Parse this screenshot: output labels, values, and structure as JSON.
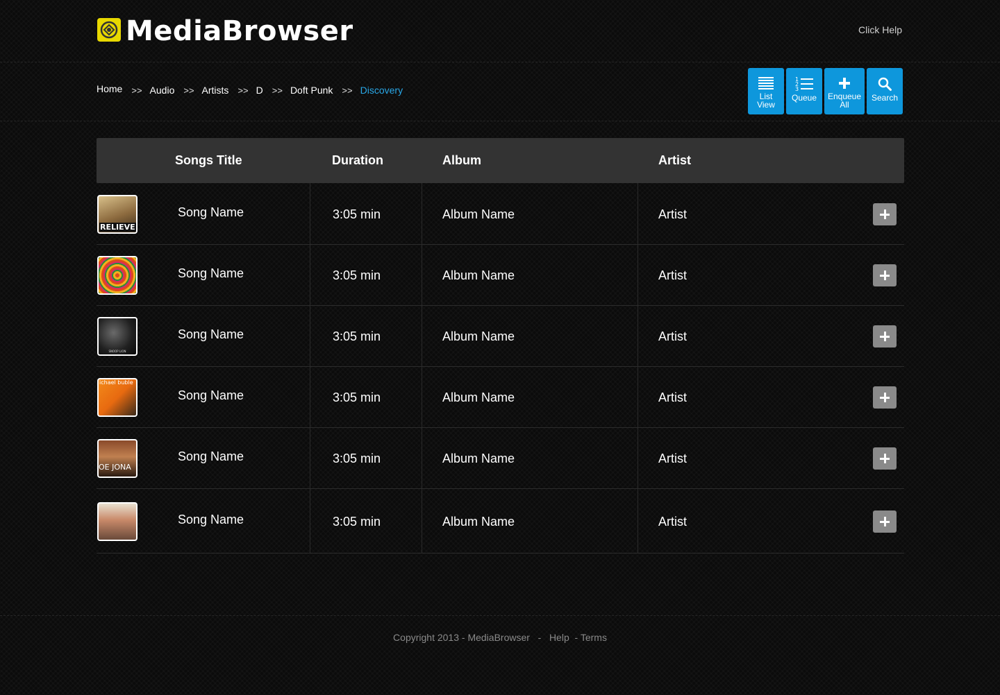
{
  "header": {
    "brand": "MediaBrowser",
    "help_link": "Click Help"
  },
  "breadcrumb": {
    "separator": ">>",
    "items": [
      "Home",
      "Audio",
      "Artists",
      "D",
      "Doft Punk"
    ],
    "current": "Discovery"
  },
  "toolbar": {
    "list_view_line1": "List",
    "list_view_line2": "View",
    "queue": "Queue",
    "enqueue_line1": "Enqueue",
    "enqueue_line2": "All",
    "search": "Search",
    "color": "#0e97dc"
  },
  "table": {
    "columns": [
      "Songs Title",
      "Duration",
      "Album",
      "Artist"
    ],
    "rows": [
      {
        "title": "Song Name",
        "duration": "3:05 min",
        "album": "Album Name",
        "artist": "Artist",
        "cover_text": "RELIEVE"
      },
      {
        "title": "Song Name",
        "duration": "3:05 min",
        "album": "Album Name",
        "artist": "Artist",
        "cover_text": ""
      },
      {
        "title": "Song Name",
        "duration": "3:05 min",
        "album": "Album Name",
        "artist": "Artist",
        "cover_text": "SNOOP LION"
      },
      {
        "title": "Song Name",
        "duration": "3:05 min",
        "album": "Album Name",
        "artist": "Artist",
        "cover_text": "ichael buble"
      },
      {
        "title": "Song Name",
        "duration": "3:05 min",
        "album": "Album Name",
        "artist": "Artist",
        "cover_text": "OE JONA"
      },
      {
        "title": "Song Name",
        "duration": "3:05 min",
        "album": "Album Name",
        "artist": "Artist",
        "cover_text": ""
      }
    ]
  },
  "footer": {
    "copyright": "Copyright 2013 - MediaBrowser",
    "dash": "-",
    "help": "Help",
    "terms": "Terms"
  }
}
